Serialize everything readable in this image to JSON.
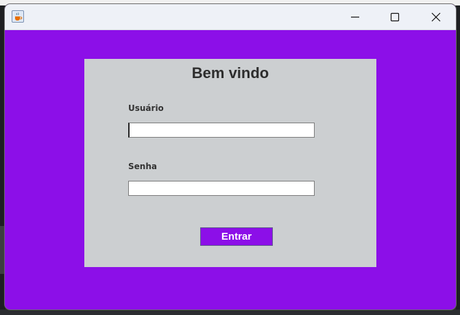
{
  "window": {
    "background_color": "#8c0fe8",
    "titlebar": {
      "app_icon": "java-coffee-icon",
      "controls": [
        "minimize-icon",
        "maximize-icon",
        "close-icon"
      ]
    }
  },
  "login": {
    "title": "Bem vindo",
    "username_label": "Usuário",
    "username_value": "",
    "password_label": "Senha",
    "password_value": "",
    "submit_label": "Entrar",
    "panel_color": "#cccfd1",
    "button_color": "#8c0fe8"
  }
}
